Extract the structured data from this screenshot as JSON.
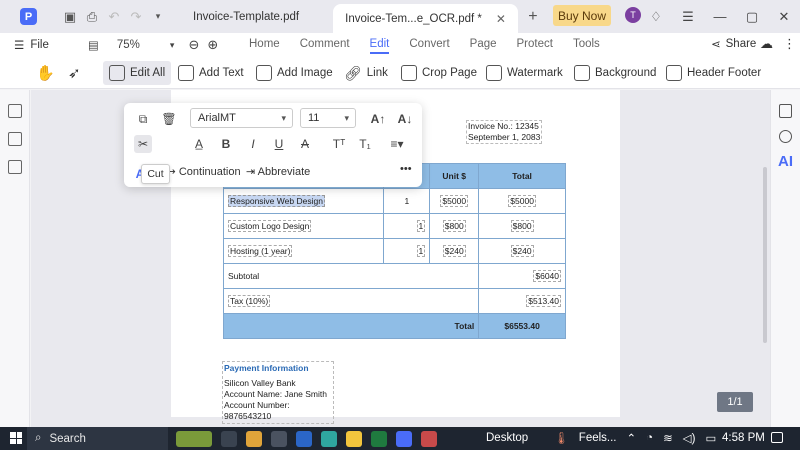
{
  "titlebar": {
    "app_logo": "P",
    "tabs": [
      {
        "label": "Invoice-Template.pdf",
        "active": false
      },
      {
        "label": "Invoice-Tem...e_OCR.pdf *",
        "active": true,
        "close": "✕"
      }
    ],
    "new_tab": "+",
    "buy_now": "Buy Now",
    "avatar": "T",
    "icons": [
      "save-icon",
      "print-icon",
      "undo-icon",
      "redo-icon",
      "chevron-down-icon",
      "bell-icon",
      "menu-icon",
      "minimize-icon",
      "maximize-icon",
      "close-icon"
    ]
  },
  "menubar": {
    "file": "File",
    "zoom": "75%",
    "tabs": [
      {
        "label": "Home",
        "active": false
      },
      {
        "label": "Comment",
        "active": false
      },
      {
        "label": "Edit",
        "active": true
      },
      {
        "label": "Convert",
        "active": false
      },
      {
        "label": "Page",
        "active": false
      },
      {
        "label": "Protect",
        "active": false
      },
      {
        "label": "Tools",
        "active": false
      }
    ],
    "share": "Share"
  },
  "toolbar": {
    "edit_all": "Edit All",
    "add_text": "Add Text",
    "add_image": "Add Image",
    "link": "Link",
    "crop_page": "Crop Page",
    "watermark": "Watermark",
    "background": "Background",
    "header_footer": "Header  Footer"
  },
  "popup": {
    "font": "ArialMT",
    "size": "11",
    "continuation": "Continuation",
    "abbreviate": "Abbreviate",
    "tooltip": "Cut",
    "more": "•••"
  },
  "invoice": {
    "number": "Invoice No.: 12345",
    "date": "September 1, 2083",
    "headers": [
      "",
      "",
      "Unit $",
      "Total"
    ],
    "rows": [
      {
        "desc": "Responsive Web Design",
        "qty": "1",
        "unit": "$5000",
        "total": "$5000",
        "selected": true
      },
      {
        "desc": "Custom Logo Design",
        "qty": "1",
        "unit": "$800",
        "total": "$800"
      },
      {
        "desc": "Hosting (1 year)",
        "qty": "1",
        "unit": "$240",
        "total": "$240"
      }
    ],
    "subtotal_label": "Subtotal",
    "subtotal": "$6040",
    "tax_label": "Tax (10%)",
    "tax": "$513.40",
    "total_label": "Total",
    "total": "$6553.40",
    "payment_header": "Payment Information",
    "bank": "Silicon Valley Bank",
    "account_name": "Account Name: Jane Smith",
    "account_number": "Account Number: 9876543210"
  },
  "page_indicator": "1/1",
  "taskbar": {
    "search": "Search",
    "desktop": "Desktop",
    "weather": "Feels...",
    "time": "4:58 PM"
  }
}
